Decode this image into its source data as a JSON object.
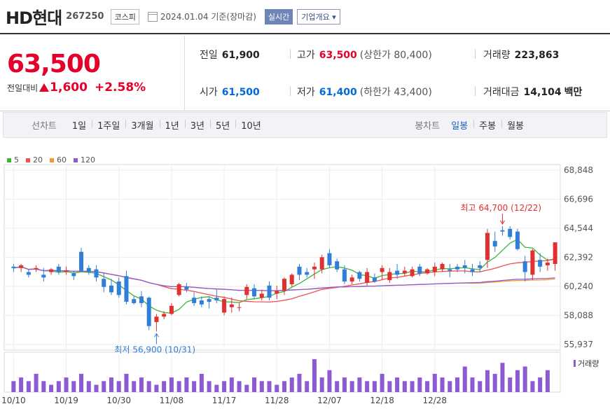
{
  "header": {
    "stock_name": "HD현대",
    "stock_code": "267250",
    "market": "코스피",
    "date_text": "2024.01.04  기준(장마감)",
    "realtime_label": "실시간",
    "company_label": "기업개요 ▾"
  },
  "price": {
    "current": "63,500",
    "prev_label": "전일대비",
    "change": "1,600",
    "change_pct": "+2.58%"
  },
  "stats": {
    "prev_close_label": "전일",
    "prev_close": "61,900",
    "high_label": "고가",
    "high": "63,500",
    "upper_limit": "(상한가 80,400)",
    "volume_label": "거래량",
    "volume": "223,863",
    "open_label": "시가",
    "open": "61,500",
    "low_label": "저가",
    "low": "61,400",
    "lower_limit": "(하한가 43,400)",
    "amount_label": "거래대금",
    "amount": "14,104",
    "amount_unit": "백만"
  },
  "period_bar": {
    "line_chart_label": "선차트",
    "periods": [
      "1일",
      "1주일",
      "3개월",
      "1년",
      "3년",
      "5년",
      "10년"
    ],
    "candle_label": "봉차트",
    "candle_types": [
      "일봉",
      "주봉",
      "월봉"
    ],
    "active_candle": 0
  },
  "legend": [
    {
      "label": "5",
      "color": "#3cb43c"
    },
    {
      "label": "20",
      "color": "#f05050"
    },
    {
      "label": "60",
      "color": "#f5962d"
    },
    {
      "label": "120",
      "color": "#8c5ad2"
    }
  ],
  "chart_data": {
    "type": "candlestick",
    "y_ticks": [
      "68,848",
      "66,696",
      "64,544",
      "62,392",
      "60,240",
      "58,088",
      "55,937"
    ],
    "ylim": [
      55937,
      68848
    ],
    "x_ticks": [
      "10/10",
      "10/19",
      "10/30",
      "11/08",
      "11/17",
      "11/28",
      "12/07",
      "12/18",
      "12/28"
    ],
    "x_tick_index": [
      0,
      7,
      14,
      21,
      28,
      35,
      42,
      49,
      56
    ],
    "high_annotation": "최고 64,700 (12/22)",
    "low_annotation": "최저 56,900 (10/31)",
    "volume_label": "거래량",
    "up_color": "#e03030",
    "down_color": "#2f7ed8",
    "candles": [
      [
        61700,
        61900,
        61300,
        61600
      ],
      [
        61600,
        61900,
        61300,
        61800
      ],
      [
        61300,
        61500,
        60900,
        61100
      ],
      [
        61500,
        61800,
        61300,
        61600
      ],
      [
        61100,
        61600,
        60600,
        60900
      ],
      [
        61300,
        61600,
        61100,
        61500
      ],
      [
        61700,
        61900,
        61100,
        61300
      ],
      [
        61300,
        61700,
        61100,
        61400
      ],
      [
        61200,
        61400,
        60700,
        61000
      ],
      [
        62800,
        63100,
        61300,
        61400
      ],
      [
        61600,
        61800,
        61100,
        61300
      ],
      [
        61500,
        61800,
        60600,
        60900
      ],
      [
        60800,
        61200,
        59800,
        60200
      ],
      [
        60300,
        60800,
        59600,
        59800
      ],
      [
        60600,
        60900,
        59400,
        59600
      ],
      [
        61000,
        61400,
        58900,
        59100
      ],
      [
        59300,
        59500,
        58900,
        59000
      ],
      [
        59500,
        59900,
        58700,
        59000
      ],
      [
        59400,
        59500,
        57000,
        57300
      ],
      [
        57600,
        58200,
        56900,
        58000
      ],
      [
        58000,
        58400,
        57800,
        58200
      ],
      [
        58200,
        59000,
        58100,
        58800
      ],
      [
        59600,
        60500,
        59500,
        60400
      ],
      [
        60200,
        60500,
        59800,
        60000
      ],
      [
        59400,
        59800,
        58800,
        59000
      ],
      [
        59200,
        59500,
        58700,
        58900
      ],
      [
        59300,
        59500,
        58600,
        59100
      ],
      [
        59400,
        60000,
        59000,
        59200
      ],
      [
        58300,
        59500,
        58100,
        59300
      ],
      [
        58700,
        59400,
        58300,
        58900
      ],
      [
        58700,
        59000,
        58400,
        58700
      ],
      [
        59600,
        60400,
        59300,
        60200
      ],
      [
        60100,
        60400,
        59300,
        59500
      ],
      [
        59400,
        60000,
        59200,
        59700
      ],
      [
        60300,
        60600,
        59200,
        59400
      ],
      [
        59700,
        60300,
        59300,
        59900
      ],
      [
        59900,
        60900,
        59600,
        60800
      ],
      [
        60400,
        61200,
        60200,
        61100
      ],
      [
        61700,
        61900,
        60700,
        61100
      ],
      [
        61300,
        61600,
        60900,
        61100
      ],
      [
        61500,
        62000,
        60800,
        61700
      ],
      [
        61500,
        62600,
        61200,
        62400
      ],
      [
        62700,
        63000,
        61600,
        61800
      ],
      [
        62100,
        62300,
        61300,
        61500
      ],
      [
        61500,
        61800,
        60400,
        60600
      ],
      [
        60600,
        61100,
        60400,
        60900
      ],
      [
        61300,
        61400,
        60600,
        60800
      ],
      [
        60500,
        61600,
        60300,
        61300
      ],
      [
        60900,
        61200,
        60500,
        60600
      ],
      [
        61300,
        61800,
        60700,
        61600
      ],
      [
        60700,
        61600,
        60500,
        61300
      ],
      [
        61400,
        61900,
        60800,
        61100
      ],
      [
        61200,
        61700,
        61000,
        61400
      ],
      [
        61000,
        61700,
        60900,
        61500
      ],
      [
        61700,
        61900,
        61000,
        61200
      ],
      [
        61200,
        61600,
        61100,
        61500
      ],
      [
        61300,
        62000,
        61000,
        61700
      ],
      [
        61500,
        62000,
        61300,
        61900
      ],
      [
        61500,
        61900,
        60900,
        61400
      ],
      [
        61700,
        61900,
        61300,
        61500
      ],
      [
        61800,
        62200,
        61200,
        61600
      ],
      [
        61500,
        61900,
        61000,
        61300
      ],
      [
        61800,
        62100,
        61300,
        61600
      ],
      [
        62200,
        64500,
        61600,
        64200
      ],
      [
        63600,
        64300,
        62800,
        63200
      ],
      [
        64400,
        64700,
        64000,
        64300
      ],
      [
        64500,
        64700,
        63700,
        63900
      ],
      [
        64300,
        64500,
        62900,
        63000
      ],
      [
        62100,
        62500,
        60600,
        61300
      ],
      [
        61100,
        63000,
        60700,
        62900
      ],
      [
        62200,
        62700,
        61300,
        61700
      ],
      [
        61800,
        62300,
        61400,
        62000
      ],
      [
        61900,
        63500,
        61400,
        63500
      ]
    ],
    "volumes": [
      3,
      4,
      3,
      5,
      3,
      2,
      3,
      4,
      3,
      5,
      3,
      2,
      3,
      4,
      3,
      5,
      3,
      4,
      3,
      2,
      3,
      4,
      3,
      4,
      3,
      5,
      3,
      2,
      3,
      4,
      3,
      2,
      4,
      3,
      3,
      2,
      3,
      4,
      5,
      3,
      9,
      4,
      6,
      3,
      4,
      3,
      4,
      3,
      3,
      5,
      3,
      4,
      3,
      3,
      4,
      3,
      5,
      4,
      3,
      4,
      7,
      4,
      3,
      6,
      5,
      8,
      4,
      6,
      7,
      3,
      4,
      6
    ]
  }
}
